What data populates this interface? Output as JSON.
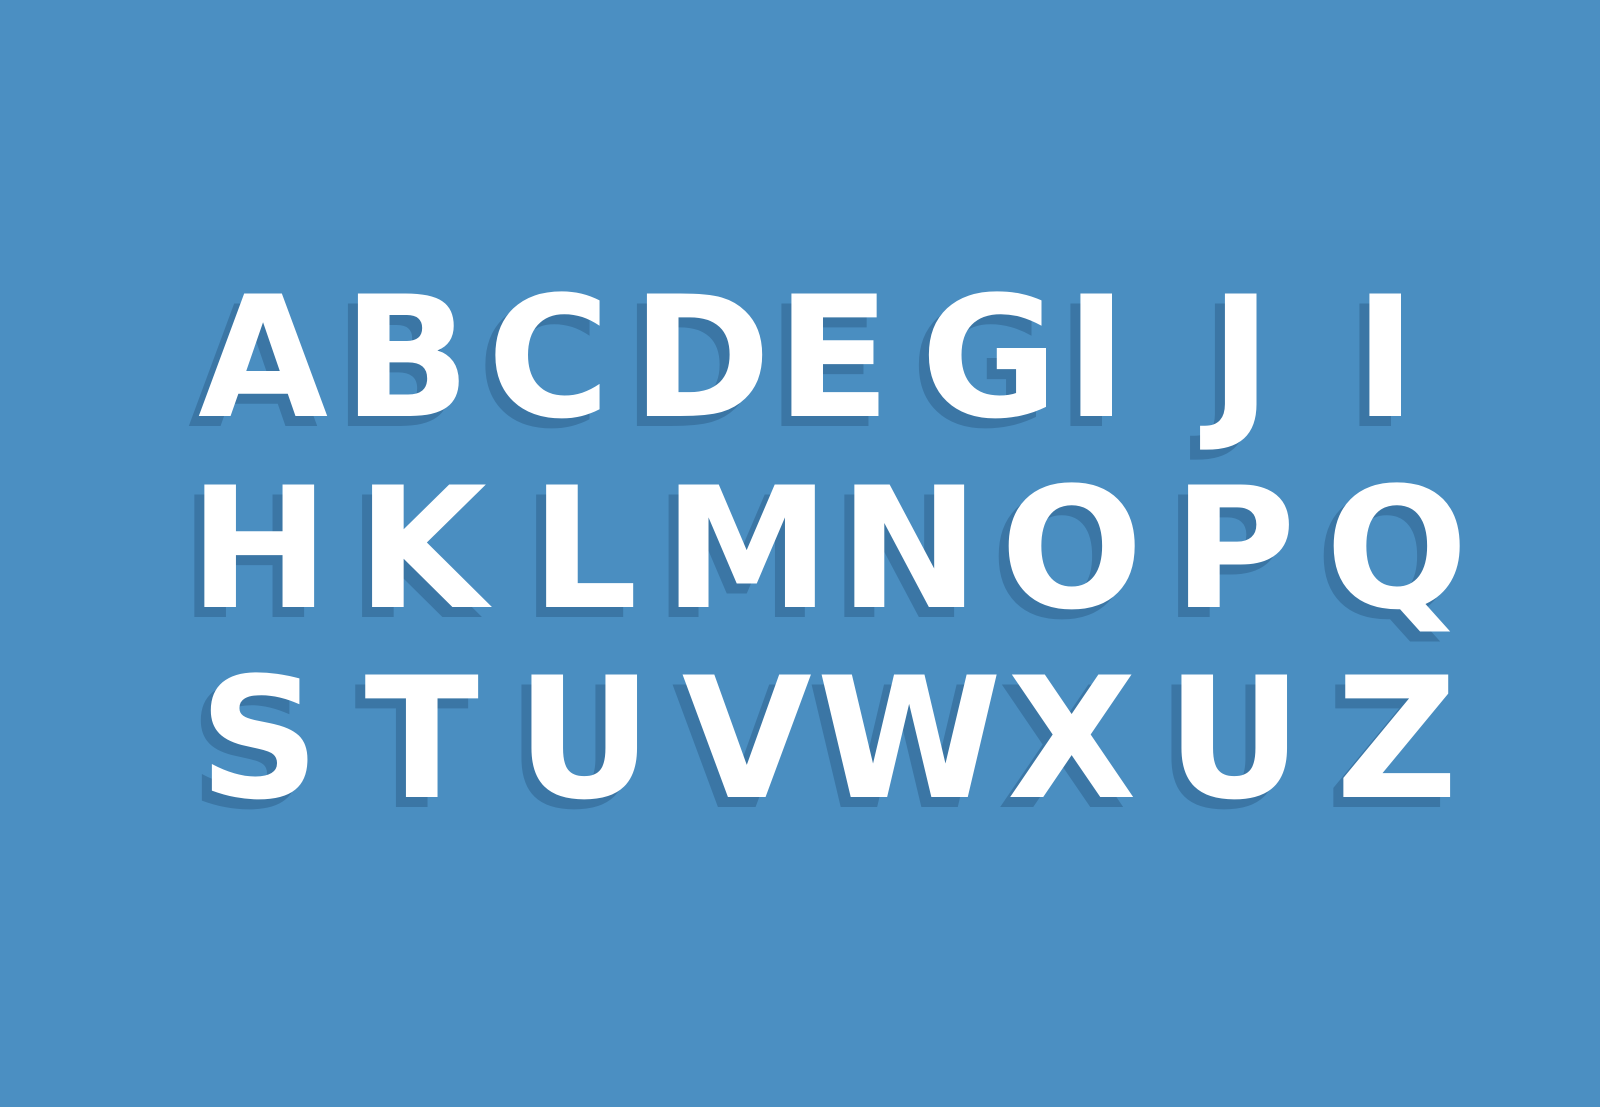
{
  "colors": {
    "background": "#4b8fc2",
    "letter": "#ffffff",
    "shadow": "#3b76a5"
  },
  "rows": [
    [
      "A",
      "B",
      "C",
      "D",
      "E",
      "G",
      "I",
      "J",
      "I"
    ],
    [
      "H",
      "K",
      "L",
      "M",
      "N",
      "O",
      "P",
      "Q"
    ],
    [
      "S",
      "T",
      "U",
      "V",
      "W",
      "X",
      "U",
      "Z"
    ]
  ]
}
